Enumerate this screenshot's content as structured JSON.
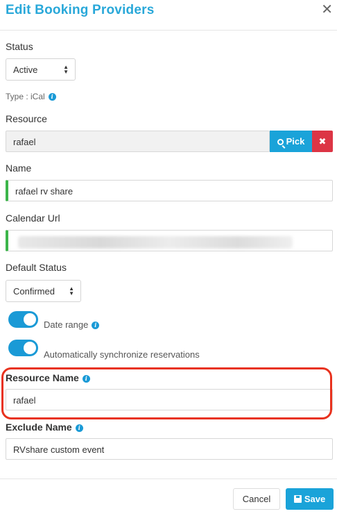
{
  "dialog": {
    "title": "Edit Booking Providers",
    "close_glyph": "✕"
  },
  "status": {
    "label": "Status",
    "value": "Active"
  },
  "type_text": "Type : iCal",
  "resource": {
    "label": "Resource",
    "value": "rafael",
    "pick_label": "Pick",
    "clear_glyph": "✖"
  },
  "name": {
    "label": "Name",
    "value": "rafael rv share"
  },
  "calendar_url": {
    "label": "Calendar Url",
    "value": ""
  },
  "default_status": {
    "label": "Default Status",
    "value": "Confirmed"
  },
  "toggles": {
    "date_range": {
      "label": "Date range",
      "on": true
    },
    "auto_sync": {
      "label": "Automatically synchronize reservations",
      "on": true
    }
  },
  "resource_name": {
    "label": "Resource Name",
    "value": "rafael"
  },
  "exclude_name": {
    "label": "Exclude Name",
    "value": "RVshare custom event"
  },
  "footer": {
    "cancel_label": "Cancel",
    "save_label": "Save"
  },
  "colors": {
    "accent": "#1aa3d9",
    "title": "#29a8d9",
    "danger": "#dc3545",
    "valid": "#3cb54a",
    "highlight": "#e8321e"
  },
  "icons": {
    "info": "info-icon",
    "search": "search-icon",
    "save": "floppy-icon",
    "close": "close-icon"
  }
}
